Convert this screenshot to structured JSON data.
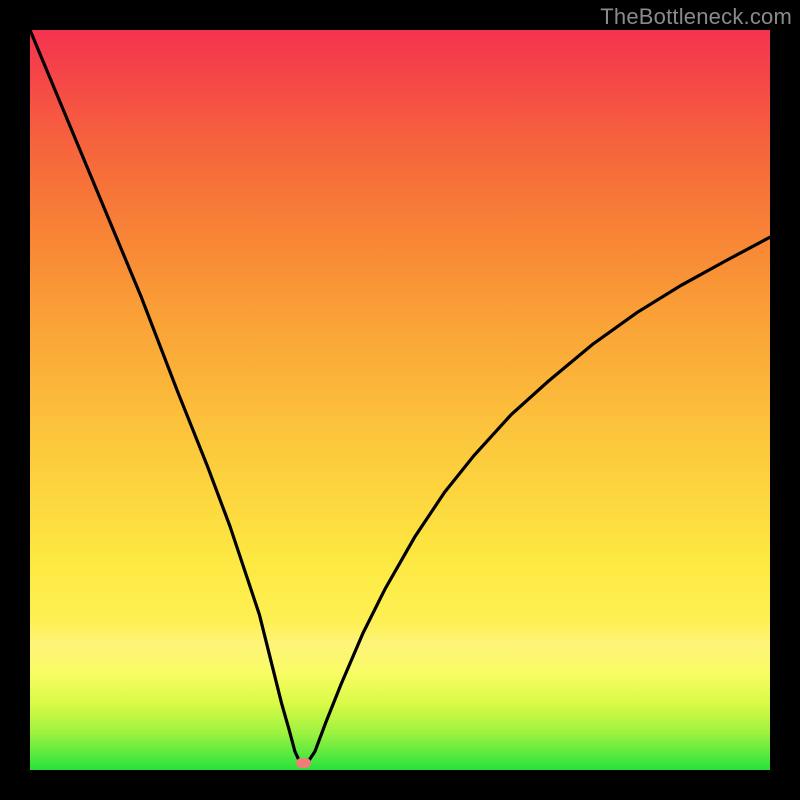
{
  "watermark": "TheBottleneck.com",
  "chart_data": {
    "type": "line",
    "title": "",
    "xlabel": "",
    "ylabel": "",
    "xlim": [
      0,
      100
    ],
    "ylim": [
      0,
      100
    ],
    "grid": false,
    "legend": false,
    "series": [
      {
        "name": "bottleneck-curve",
        "color": "#000000",
        "x": [
          0,
          5,
          10,
          15,
          20,
          24,
          27,
          30,
          31,
          32,
          33,
          34,
          35,
          35.8,
          36.5,
          37.5,
          38.5,
          40,
          42,
          45,
          48,
          52,
          56,
          60,
          65,
          70,
          76,
          82,
          88,
          94,
          100
        ],
        "y": [
          100,
          88,
          76,
          64,
          51,
          41,
          33,
          24,
          21,
          17,
          13,
          9,
          5.5,
          2.5,
          1,
          1,
          2.5,
          6.5,
          11.5,
          18.5,
          24.5,
          31.5,
          37.5,
          42.5,
          48,
          52.5,
          57.5,
          61.8,
          65.5,
          68.8,
          72
        ]
      }
    ],
    "marker": {
      "name": "optimal-point",
      "x": 37,
      "y": 1,
      "color": "#ef7e79"
    },
    "background_gradient": {
      "type": "vertical",
      "stops": [
        {
          "pos": 0,
          "color": "#28e23c"
        },
        {
          "pos": 20,
          "color": "#fef053"
        },
        {
          "pos": 60,
          "color": "#fa9f37"
        },
        {
          "pos": 100,
          "color": "#f5334f"
        }
      ]
    }
  }
}
